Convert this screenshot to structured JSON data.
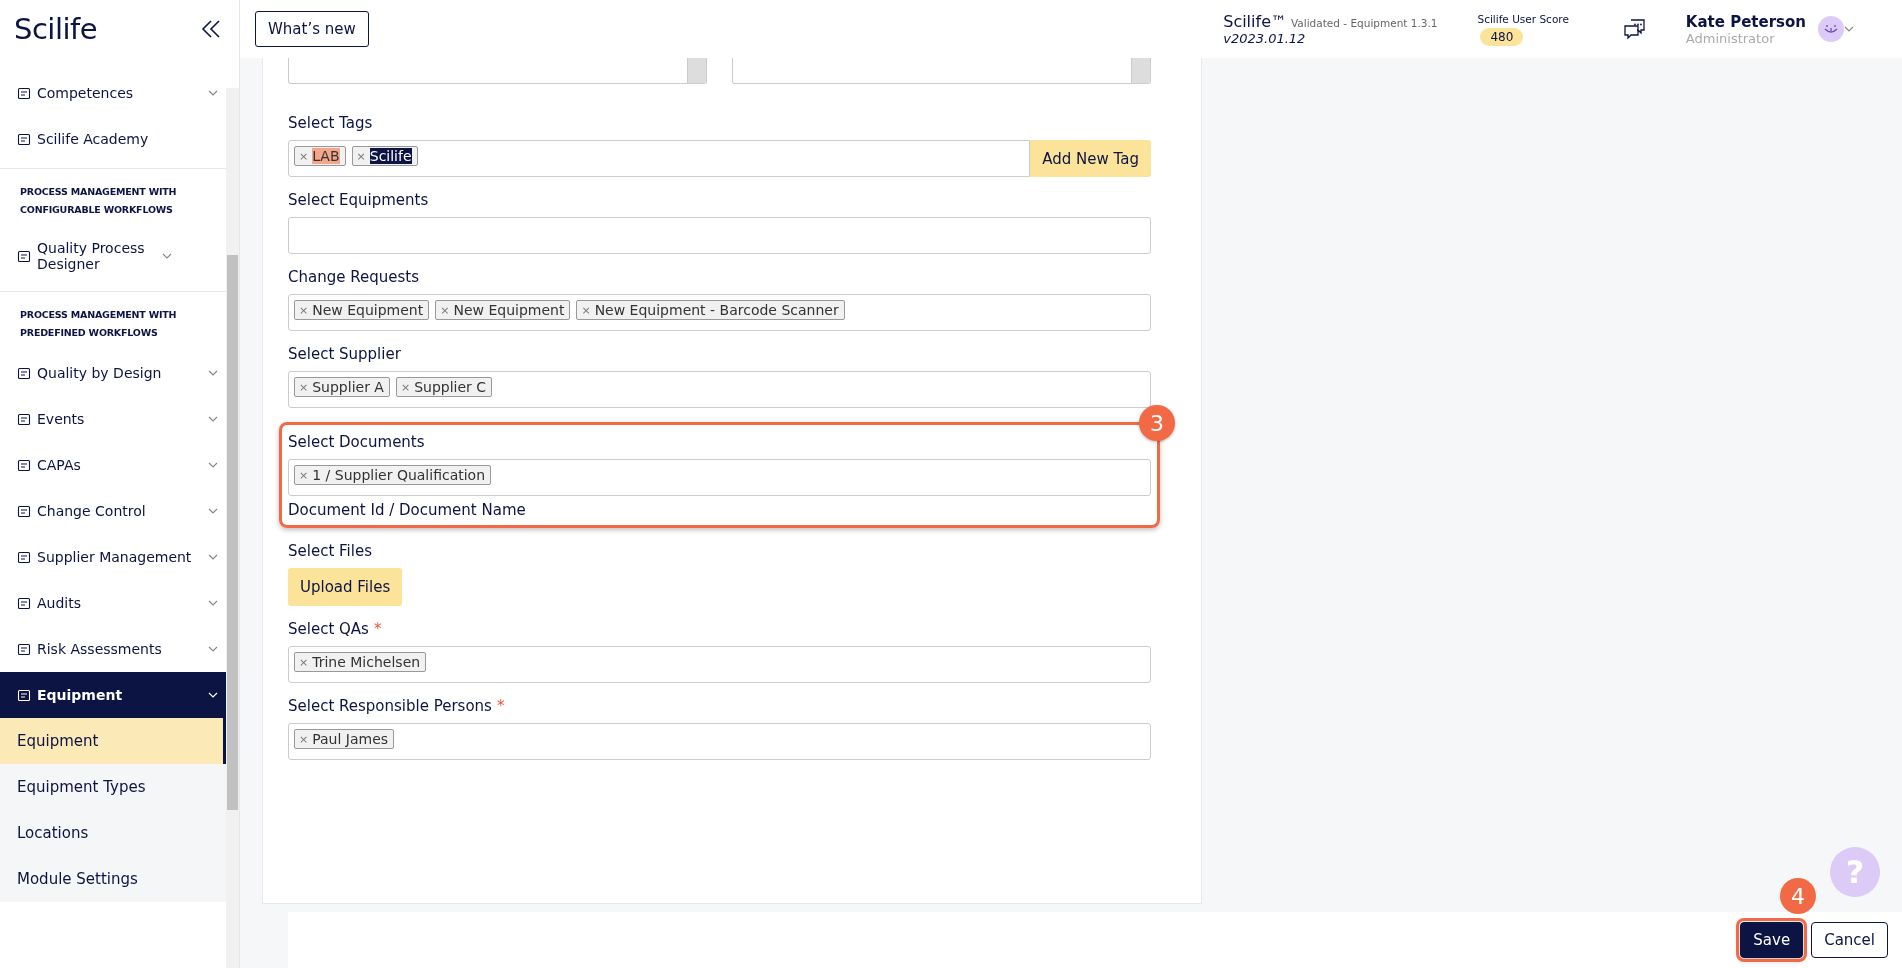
{
  "sidebar": {
    "logo": "Scilife",
    "items": [
      {
        "kind": "item",
        "label": "Competences",
        "expandable": true,
        "selected": false
      },
      {
        "kind": "item",
        "label": "Scilife Academy",
        "expandable": false,
        "selected": false
      },
      {
        "kind": "section",
        "label": "PROCESS MANAGEMENT WITH CONFIGURABLE WORKFLOWS"
      },
      {
        "kind": "item",
        "label": "Quality Process Designer",
        "expandable": true,
        "selected": false
      },
      {
        "kind": "section",
        "label": "PROCESS MANAGEMENT WITH PREDEFINED WORKFLOWS"
      },
      {
        "kind": "item",
        "label": "Quality by Design",
        "expandable": true,
        "selected": false
      },
      {
        "kind": "item",
        "label": "Events",
        "expandable": true,
        "selected": false
      },
      {
        "kind": "item",
        "label": "CAPAs",
        "expandable": true,
        "selected": false
      },
      {
        "kind": "item",
        "label": "Change Control",
        "expandable": true,
        "selected": false
      },
      {
        "kind": "item",
        "label": "Supplier Management",
        "expandable": true,
        "selected": false
      },
      {
        "kind": "item",
        "label": "Audits",
        "expandable": true,
        "selected": false
      },
      {
        "kind": "item",
        "label": "Risk Assessments",
        "expandable": true,
        "selected": false
      },
      {
        "kind": "item",
        "label": "Equipment",
        "expandable": true,
        "selected": true,
        "children": [
          {
            "label": "Equipment",
            "selected": true
          },
          {
            "label": "Equipment Types",
            "selected": false
          },
          {
            "label": "Locations",
            "selected": false
          },
          {
            "label": "Module Settings",
            "selected": false
          }
        ]
      }
    ]
  },
  "header": {
    "whats_new": "What’s new",
    "product": "Scilife™",
    "edition": "Validated - Equipment 1.3.1",
    "version": "v2023.01.12",
    "score_label": "Scilife User Score",
    "score": "480",
    "user_name": "Kate Peterson",
    "user_role": "Administrator"
  },
  "form": {
    "remove_glyph": "×",
    "fields": [
      {
        "kind": "cut-pair"
      },
      {
        "kind": "tags",
        "label": "Select Tags",
        "button": "Add New Tag",
        "tags": [
          {
            "text": "LAB",
            "color": "#f4a58a"
          },
          {
            "text": "Scilife",
            "color": "#0b1442"
          }
        ]
      },
      {
        "kind": "multi",
        "label": "Select Equipments"
      },
      {
        "kind": "multi",
        "label": "Change Requests",
        "values": [
          "New Equipment",
          "New Equipment",
          "New Equipment - Barcode Scanner"
        ]
      },
      {
        "kind": "multi",
        "label": "Select Supplier",
        "values": [
          "Supplier A",
          "Supplier C"
        ]
      },
      {
        "kind": "multi",
        "label": "Select Documents",
        "values": [
          "1 / Supplier Qualification"
        ],
        "hint": "Document Id / Document Name",
        "callout": "3"
      },
      {
        "kind": "upload",
        "label": "Select Files",
        "button": "Upload Files"
      },
      {
        "kind": "multi",
        "label": "Select QAs",
        "required_mark": "*",
        "values": [
          "Trine Michelsen"
        ]
      },
      {
        "kind": "multi",
        "label": "Select Responsible Persons",
        "required_mark": "*",
        "values": [
          "Paul James"
        ]
      }
    ]
  },
  "help": "?",
  "actions": [
    {
      "label": "Save",
      "kind": "primary",
      "callout": "4"
    },
    {
      "label": "Cancel",
      "kind": "secondary"
    }
  ]
}
